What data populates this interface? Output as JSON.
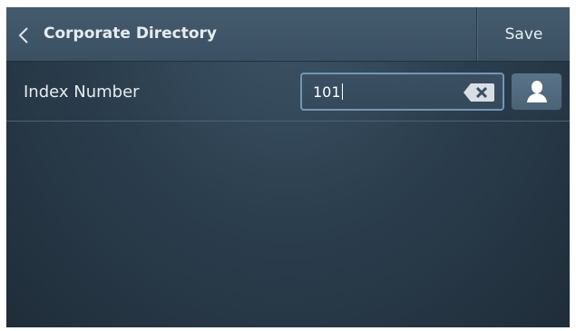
{
  "header": {
    "title": "Corporate Directory",
    "save_label": "Save"
  },
  "form": {
    "index_label": "Index Number",
    "index_value": "101"
  },
  "icons": {
    "back": "chevron-left-icon",
    "clear": "backspace-clear-icon",
    "contact": "person-icon"
  },
  "colors": {
    "input_border": "#7596b3",
    "header_bg": "#445b6d",
    "screen_bg": "#2c3f4f"
  }
}
